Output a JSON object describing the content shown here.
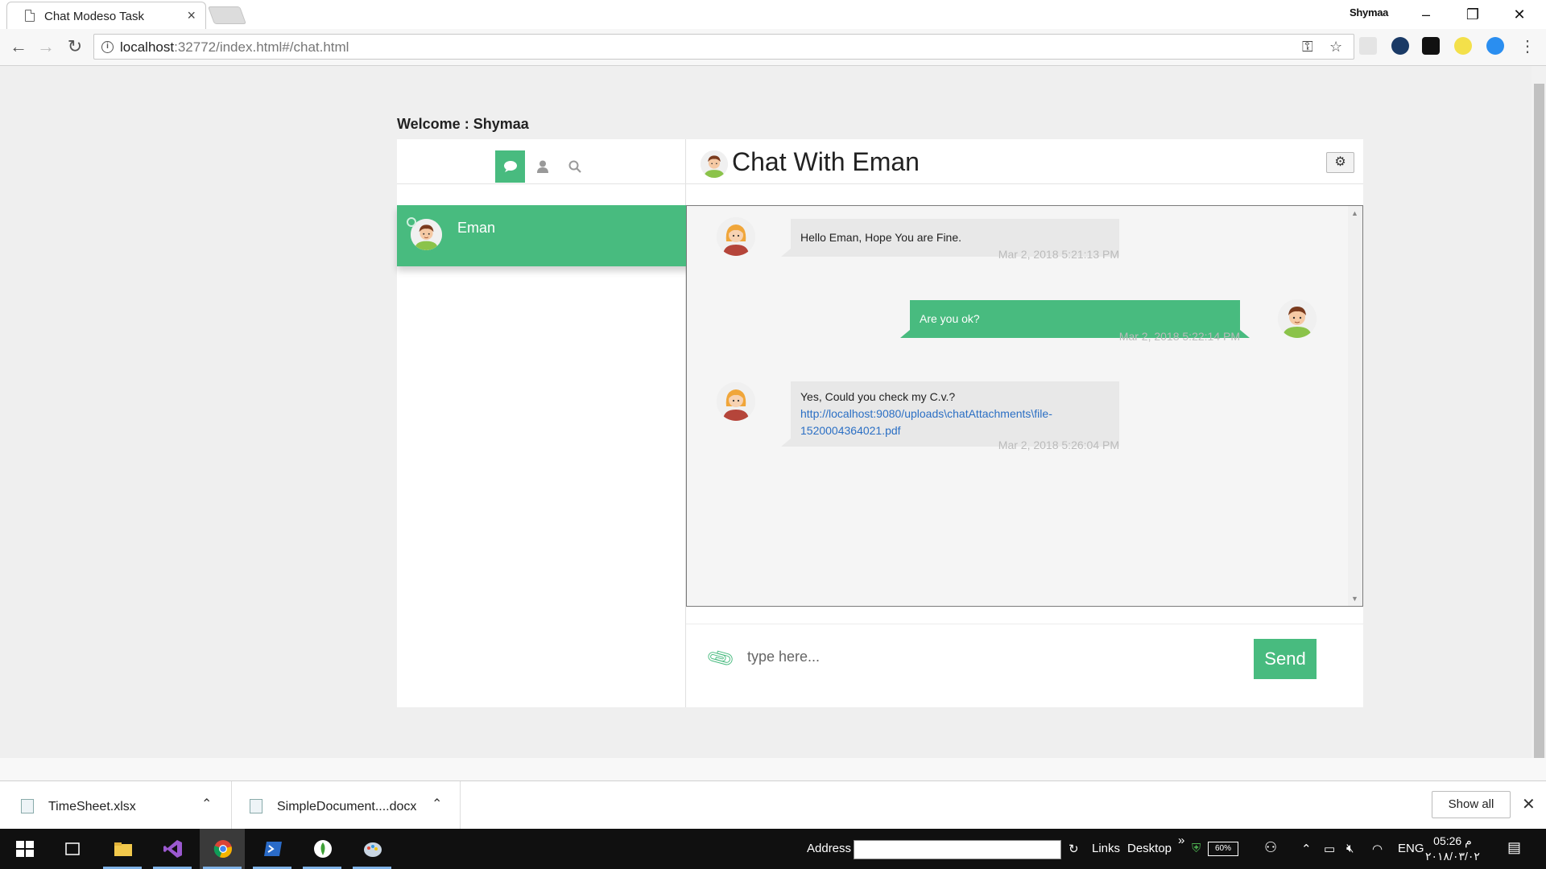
{
  "browser": {
    "tab_title": "Chat Modeso Task",
    "tab_close": "×",
    "profile_name": "Shymaa",
    "window_controls": {
      "minimize": "–",
      "restore": "❐",
      "close": "✕"
    },
    "nav": {
      "back": "←",
      "forward": "→",
      "reload": "↻"
    },
    "url_host": "localhost",
    "url_rest": ":32772/index.html#/chat.html",
    "omnibox_icons": [
      "key-icon",
      "star-icon"
    ],
    "extension_icons": [
      "camera-icon",
      "grammarly-icon",
      "lock-extension-icon",
      "lightbulb-icon",
      "zoom-icon",
      "menu-icon"
    ]
  },
  "app": {
    "welcome": "Welcome : Shymaa",
    "sidebar": {
      "tabs": [
        {
          "icon": "chat-bubble-icon",
          "active": true
        },
        {
          "icon": "user-icon",
          "active": false
        },
        {
          "icon": "search-icon",
          "active": false
        }
      ],
      "contacts": [
        {
          "name": "Eman",
          "online": true,
          "selected": true
        }
      ]
    },
    "chat": {
      "title": "Chat With Eman",
      "settings_icon": "gear-icon",
      "messages": [
        {
          "direction": "in",
          "text": "Hello Eman, Hope You are Fine.",
          "time": "Mar 2, 2018 5:21:13 PM"
        },
        {
          "direction": "out",
          "text": "Are you ok?",
          "time": "Mar 2, 2018 5:22:14 PM"
        },
        {
          "direction": "in",
          "text": "Yes, Could you check my C.v.?",
          "link": "http://localhost:9080/uploads\\chatAttachments\\file-1520004364021.pdf",
          "time": "Mar 2, 2018 5:26:04 PM"
        }
      ],
      "composer": {
        "placeholder": "type here...",
        "send_label": "Send",
        "attach_icon": "paperclip-icon"
      }
    }
  },
  "downloads": {
    "items": [
      {
        "name": "TimeSheet.xlsx"
      },
      {
        "name": "SimpleDocument....docx"
      }
    ],
    "show_all": "Show all",
    "close": "✕"
  },
  "taskbar": {
    "apps": [
      "windows-start-icon",
      "task-view-icon",
      "file-explorer-icon",
      "visual-studio-icon",
      "chrome-icon",
      "powershell-icon",
      "mongodb-icon",
      "paint-icon"
    ],
    "address_label": "Address",
    "links_label": "Links",
    "desktop_label": "Desktop",
    "chevron": "»",
    "battery": "60%",
    "language": "ENG",
    "time": "05:26 م",
    "date": "٢٠١٨/٠٣/٠٢"
  },
  "colors": {
    "accent": "#48bb7f",
    "page_bg": "#efefef",
    "link": "#2b6fc4"
  }
}
